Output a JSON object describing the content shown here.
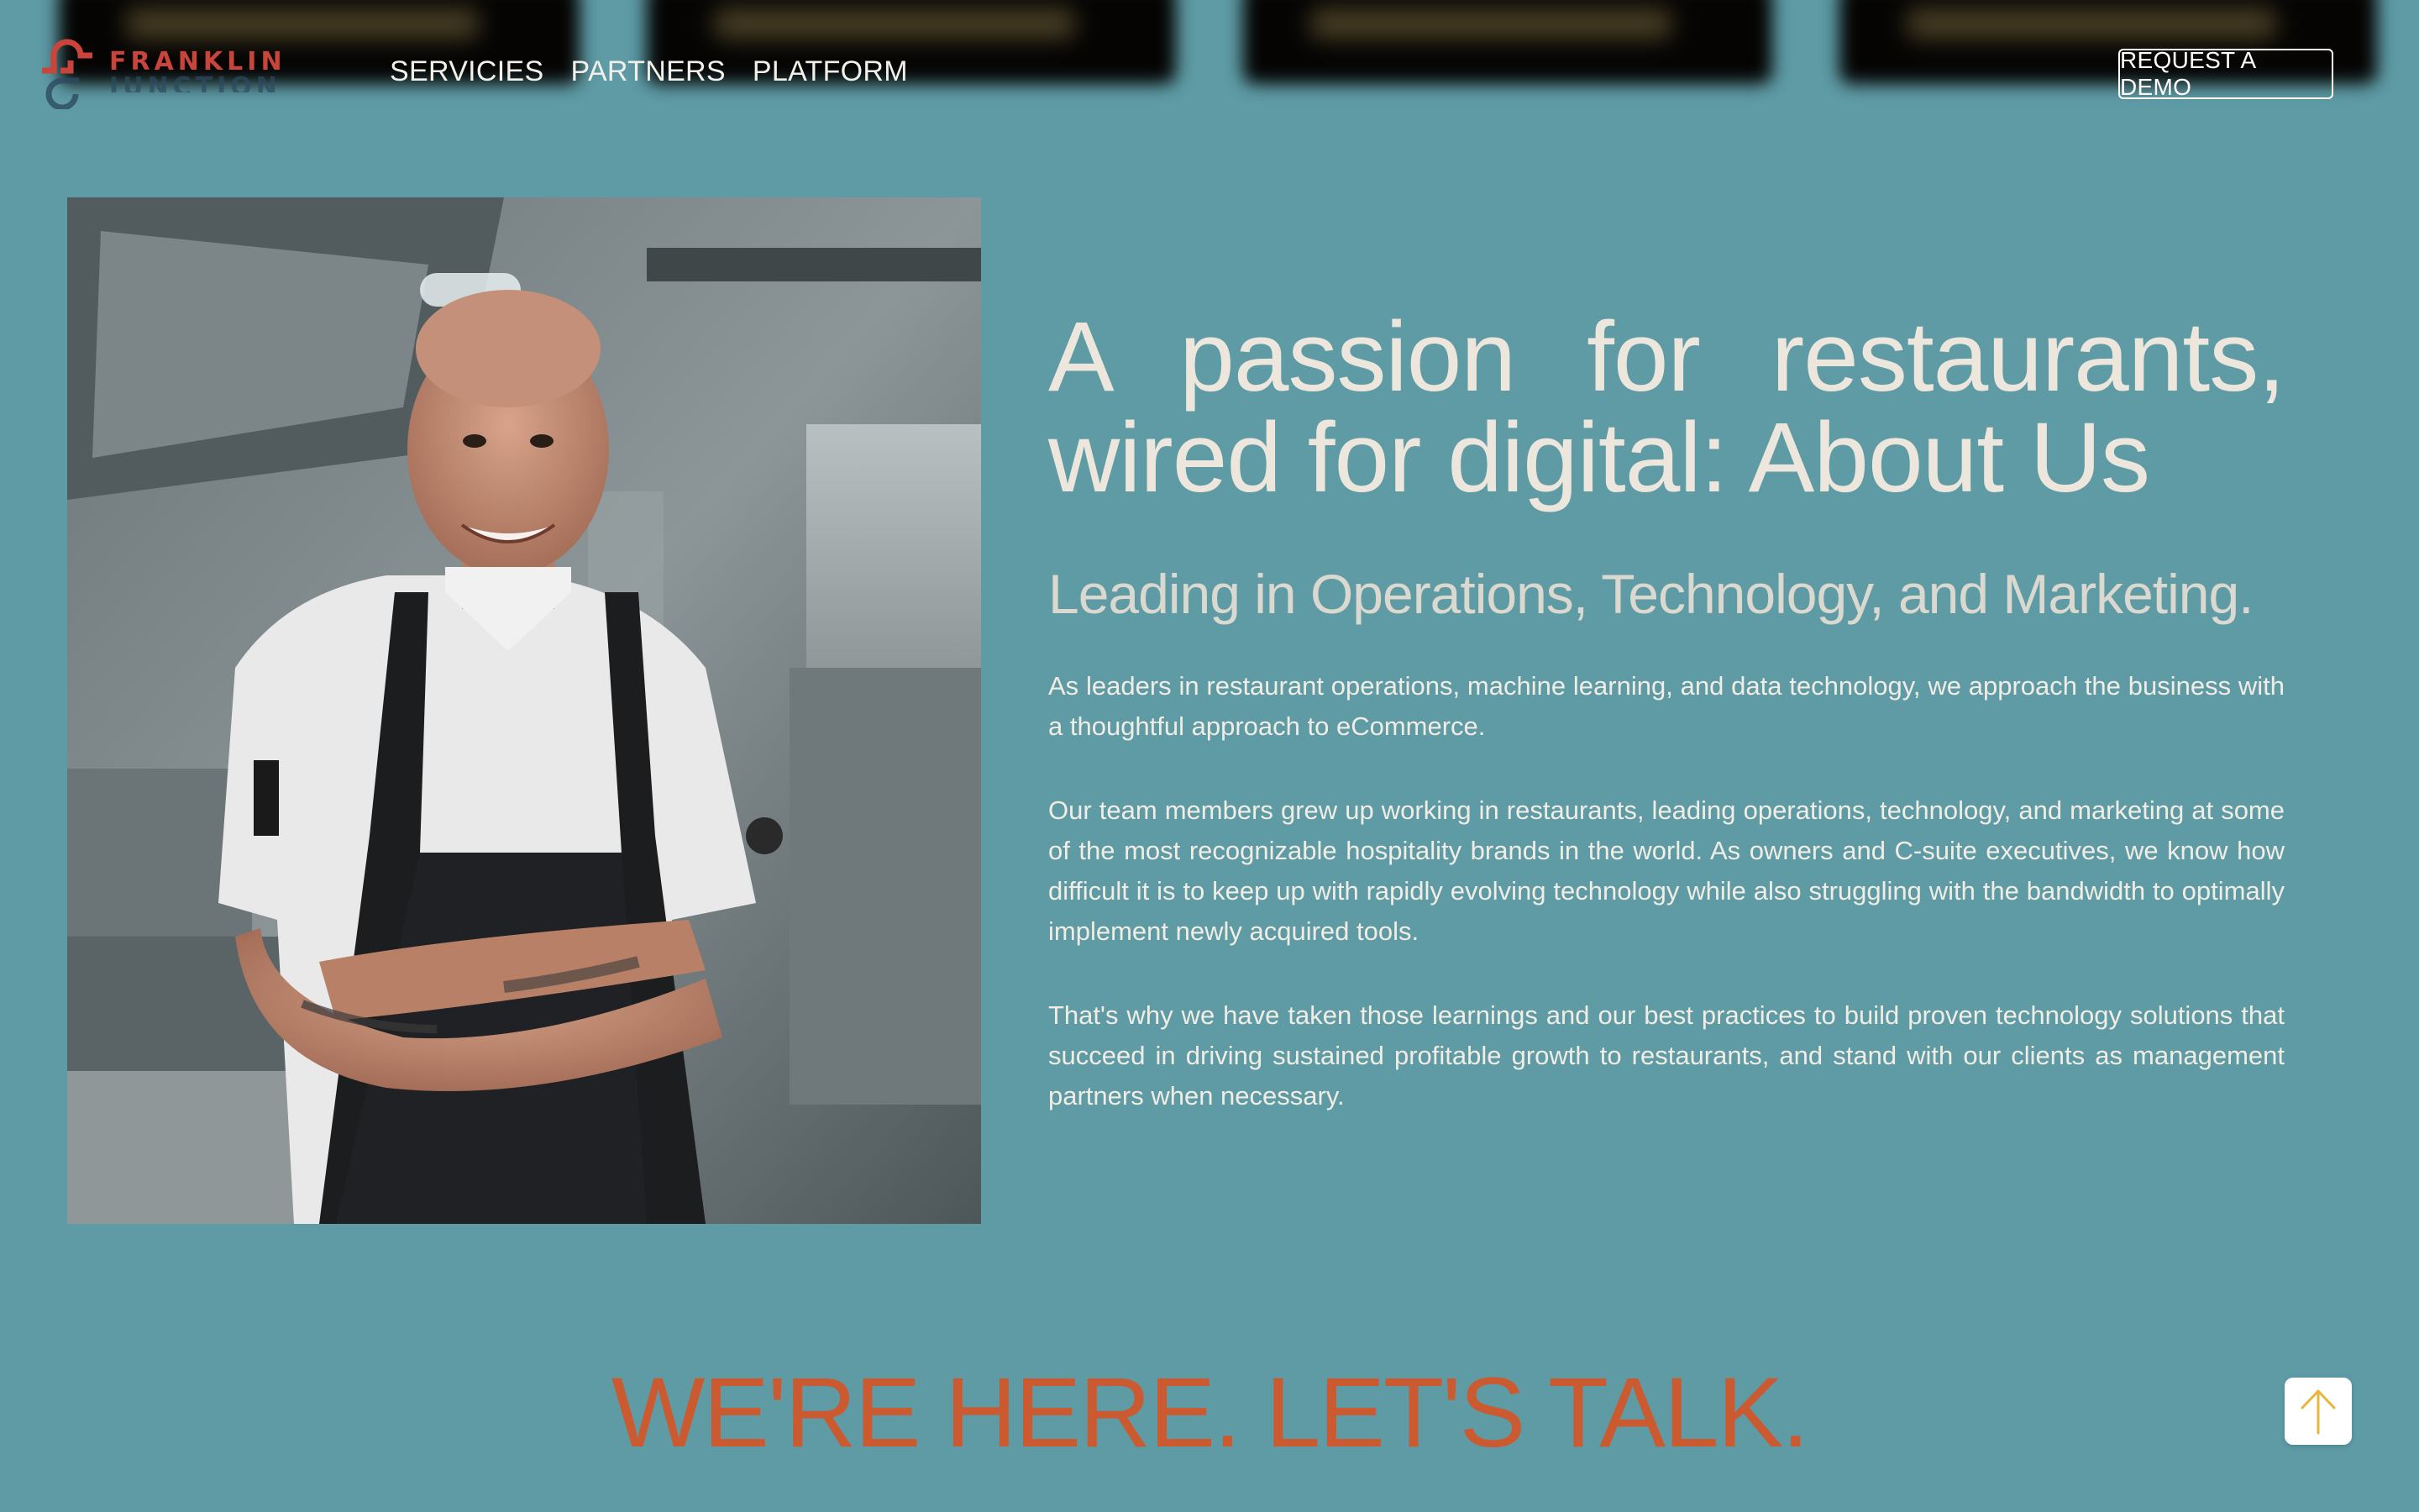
{
  "brand": {
    "name_top": "FRANKLIN",
    "name_bottom": "JUNCTION"
  },
  "nav": {
    "items": [
      {
        "label": "SERVICIES"
      },
      {
        "label": "PARTNERS"
      },
      {
        "label": "PLATFORM"
      }
    ],
    "cta_label": "REQUEST A DEMO"
  },
  "hero": {
    "title": "A passion for restaurants, wired for digital: About Us",
    "subtitle": "Leading in Operations, Technology, and Marketing.",
    "paragraphs": [
      "As leaders in restaurant operations, machine learning, and data technology, we approach the business with a thoughtful approach to eCommerce.",
      "Our team members grew up working in restaurants, leading operations, technology, and marketing at some of the most recognizable hospitality brands in the world. As owners and C-suite executives, we know how difficult it is to keep up with rapidly evolving technology while also struggling with the bandwidth to optimally implement newly acquired tools.",
      "That's why we have taken those learnings and our best practices to build proven technology solutions that succeed in driving sustained profitable growth to restaurants, and stand with our clients as management partners when necessary."
    ]
  },
  "cta_banner": {
    "text": "WE'RE HERE. LET'S TALK."
  },
  "icons": {
    "scroll_top": "arrow-up-icon",
    "photo": "chef-in-kitchen-photo"
  },
  "colors": {
    "background": "#5e9ba5",
    "brand_red": "#c9443a",
    "cta_orange": "#cc5a30",
    "heading_text": "#ece6dc",
    "arrow_yellow": "#e9b53a"
  }
}
